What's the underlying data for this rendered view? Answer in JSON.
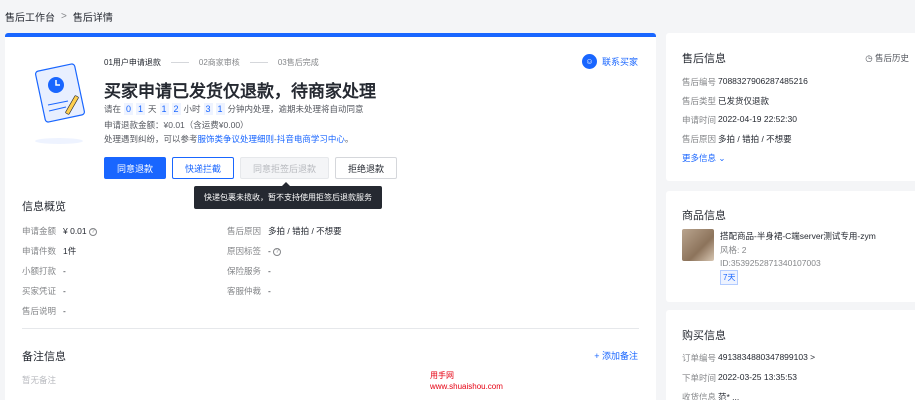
{
  "breadcrumb": {
    "items": [
      "售后工作台",
      "售后详情"
    ],
    "separator": ">"
  },
  "steps": [
    {
      "label": "01用户申请退款",
      "active": true
    },
    {
      "label": "02商家审核",
      "active": false
    },
    {
      "label": "03售后完成",
      "active": false
    }
  ],
  "contact_label": "联系买家",
  "title": "买家申请已发货仅退款，待商家处理",
  "countdown": {
    "prefix": "请在",
    "d1": "0",
    "d2": "1",
    "day_unit": "天",
    "h1": "1",
    "h2": "2",
    "hour_unit": "小时",
    "m1": "3",
    "m2": "1",
    "suffix": "分钟内处理，逾期未处理将自动同意"
  },
  "refund_amount": "申请退款金额：¥0.01（含运费¥0.00）",
  "dispute": {
    "prefix": "处理遇到纠纷，可以参考",
    "link1": "服饰类争议处理细则",
    "mid": "-",
    "link2": "抖音电商学习中心",
    "suffix": "。"
  },
  "actions": {
    "agree": "同意退款",
    "intercept": "快递拦截",
    "sign_reject": "同意拒签后退款",
    "reject": "拒绝退款"
  },
  "tooltip": "快递包裹未揽收，暂不支持使用拒签后退款服务",
  "info_overview": {
    "title": "信息概览",
    "rows": [
      {
        "k": "申请金额",
        "v": "¥ 0.01",
        "k2": "售后原因",
        "v2": "多拍 / 错拍 / 不想要"
      },
      {
        "k": "申请件数",
        "v": "1件",
        "k2": "原因标签",
        "v2": "-"
      },
      {
        "k": "小额打款",
        "v": "-",
        "k2": "保险服务",
        "v2": "-"
      },
      {
        "k": "买家凭证",
        "v": "-",
        "k2": "客服仲裁",
        "v2": "-"
      },
      {
        "k": "售后说明",
        "v": "-",
        "k2": "",
        "v2": ""
      }
    ]
  },
  "remarks": {
    "title": "备注信息",
    "add": "+ 添加备注",
    "empty": "暂无备注"
  },
  "watermark": {
    "line1": "用手网",
    "line2": "www.shuaishou.com"
  },
  "aftersale_info": {
    "title": "售后信息",
    "history": "售后历史",
    "rows": [
      {
        "k": "售后编号",
        "v": "7088327906287485216"
      },
      {
        "k": "售后类型",
        "v": "已发货仅退款"
      },
      {
        "k": "申请时间",
        "v": "2022-04-19 22:52:30"
      },
      {
        "k": "售后原因",
        "v": "多拍 / 错拍 / 不想要"
      }
    ],
    "more": "更多信息"
  },
  "product_info": {
    "title": "商品信息",
    "name": "搭配商品-半身裙-C端server测试专用-zym",
    "spec": "风格: 2",
    "id": "ID:3539252871340107003",
    "tag": "7天"
  },
  "purchase_info": {
    "title": "购买信息",
    "rows": [
      {
        "k": "订单编号",
        "v": "4913834880347899103 >"
      },
      {
        "k": "下单时间",
        "v": "2022-03-25 13:35:53"
      },
      {
        "k": "收货信息",
        "v": "范* ..."
      }
    ]
  },
  "colors": {
    "accent": "#1966ff",
    "text": "#252931",
    "muted": "#85878a",
    "background": "#f4f5f7"
  }
}
